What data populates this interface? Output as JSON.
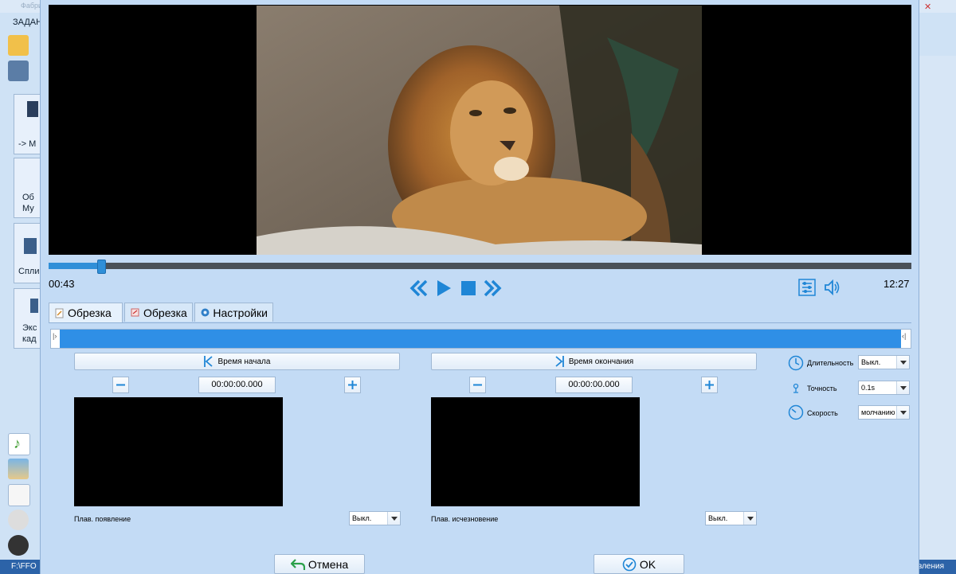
{
  "background_app": {
    "title": "Фабрика",
    "menu_label": "ЗАДАНИ",
    "side_tiles": [
      "-> M",
      "Об\nМу",
      "Спли",
      "Экс\nкад"
    ],
    "status_left": "F:\\FFO",
    "status_right": "вления"
  },
  "player": {
    "current_time": "00:43",
    "total_time": "12:27",
    "progress": 0.061
  },
  "tabs": [
    {
      "label": "Обрезка",
      "icon": "scissors-doc-icon",
      "active": true
    },
    {
      "label": "Обрезка",
      "icon": "crop-icon",
      "active": false
    },
    {
      "label": "Настройки",
      "icon": "gear-icon",
      "active": false
    }
  ],
  "trim": {
    "start_button": "Время начала",
    "end_button": "Время окончания",
    "start_time": "00:00:00.000",
    "end_time": "00:00:00.000",
    "fade_in_label": "Плав. появление",
    "fade_in_value": "Выкл.",
    "fade_out_label": "Плав. исчезновение",
    "fade_out_value": "Выкл."
  },
  "options": {
    "duration_label": "Длительность",
    "duration_value": "Выкл.",
    "accuracy_label": "Точность",
    "accuracy_value": "0.1s",
    "speed_label": "Скорость",
    "speed_value": "молчанию"
  },
  "footer": {
    "cancel_label": "Отмена",
    "ok_label": "OK"
  },
  "colors": {
    "accent": "#2f8fe6",
    "dialog_bg": "#c3dbf5"
  }
}
